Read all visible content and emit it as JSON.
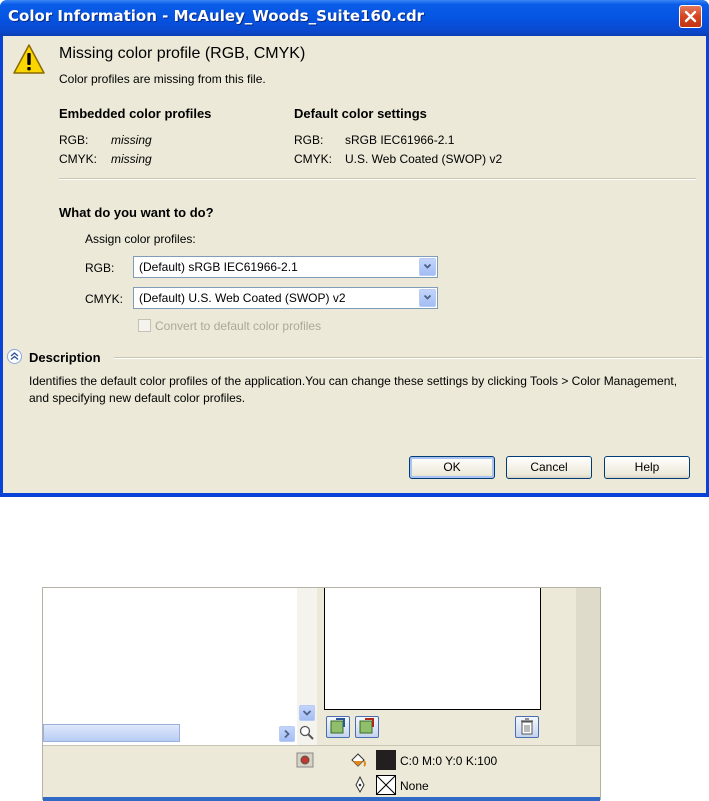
{
  "dialog": {
    "title": "Color Information - McAuley_Woods_Suite160.cdr",
    "heading": "Missing color profile (RGB, CMYK)",
    "subheading": "Color profiles are missing from this file.",
    "embedded": {
      "header": "Embedded color profiles",
      "rgb_label": "RGB:",
      "rgb_value": "missing",
      "cmyk_label": "CMYK:",
      "cmyk_value": "missing"
    },
    "defaults": {
      "header": "Default color settings",
      "rgb_label": "RGB:",
      "rgb_value": "sRGB IEC61966-2.1",
      "cmyk_label": "CMYK:",
      "cmyk_value": "U.S. Web Coated (SWOP) v2"
    },
    "question": "What do you want to do?",
    "assign_label": "Assign color profiles:",
    "rgb_select_label": "RGB:",
    "rgb_select_value": "(Default) sRGB IEC61966-2.1",
    "cmyk_select_label": "CMYK:",
    "cmyk_select_value": "(Default) U.S. Web Coated (SWOP) v2",
    "convert_label": "Convert to default color profiles",
    "description_header": "Description",
    "description_text": "Identifies the default color profiles of the application.You can change these settings by clicking Tools > Color Management, and specifying new default color profiles.",
    "buttons": {
      "ok": "OK",
      "cancel": "Cancel",
      "help": "Help"
    }
  },
  "status": {
    "fill_value": "C:0 M:0 Y:0 K:100",
    "outline_value": "None"
  },
  "colors": {
    "title_bar": "#0554e3",
    "dialog_bg": "#ece9d8",
    "fill_swatch": "#231f20"
  }
}
